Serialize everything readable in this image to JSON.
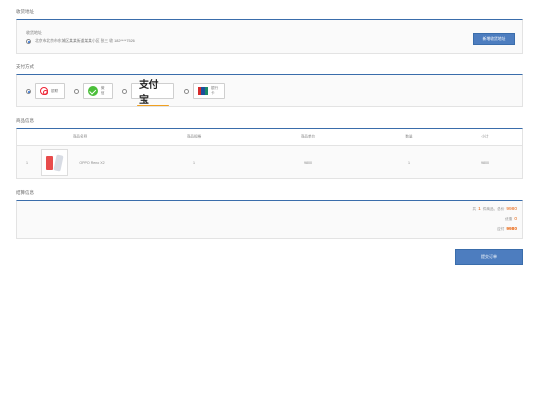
{
  "sections": {
    "address": "收货地址",
    "payment": "支付方式",
    "goods": "商品信息",
    "summary": "结算信息"
  },
  "address": {
    "label": "收货地址",
    "detail": "北京市北京市东城区某某街道某某小区 张三 收 182****7526",
    "button": "新增收货地址"
  },
  "payment": {
    "options": [
      {
        "label": "银联",
        "icon": "unionpay-icon",
        "checked": true
      },
      {
        "label": "微信",
        "icon": "wechat-icon",
        "checked": false
      },
      {
        "label": "支付宝",
        "icon": "alipay-logo",
        "checked": false
      },
      {
        "label": "银行卡",
        "icon": "bank-card-icon",
        "checked": false
      }
    ]
  },
  "goods": {
    "headers": [
      "商品名称",
      "商品规格",
      "商品单价",
      "数量",
      "小计"
    ],
    "rows": [
      {
        "index": "1",
        "name": "OPPO Reno X2",
        "spec": "1",
        "price": "9800",
        "qty": "1",
        "subtotal": "9800"
      }
    ]
  },
  "summary": {
    "count_prefix": "共",
    "count": "1",
    "count_suffix": "件商品，总价",
    "total": "9980",
    "discount_label": "优惠",
    "discount": "0",
    "pay_label": "应付",
    "pay": "9980"
  },
  "submit": "提交订单",
  "colors": {
    "accent": "#3a6dab",
    "price": "#e8620c"
  }
}
